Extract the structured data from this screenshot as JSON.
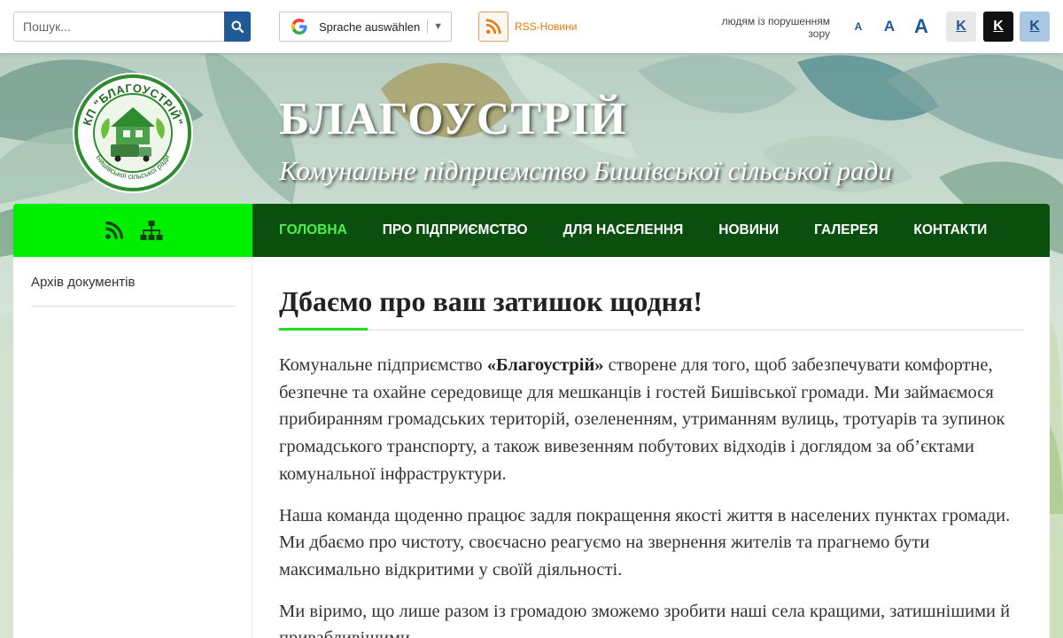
{
  "search": {
    "placeholder": "Пошук..."
  },
  "translate": {
    "label": "Sprache auswählen",
    "caret": "▼"
  },
  "rss_top": {
    "label": "RSS-Новини"
  },
  "accessibility": {
    "label": "людям із порушенням зору",
    "font_sizes": [
      "A",
      "A",
      "A"
    ],
    "contrast_buttons": [
      "K",
      "K",
      "K"
    ]
  },
  "header": {
    "title": "БЛАГОУСТРІЙ",
    "subtitle": "Комунальне підприємство Бишівської сільської ради",
    "logo_top": "КП \"БЛАГОУСТРІЙ\"",
    "logo_bottom": "Бишівської сільської ради"
  },
  "nav": {
    "items": [
      {
        "label": "ГОЛОВНА",
        "active": true
      },
      {
        "label": "ПРО ПІДПРИЄМСТВО",
        "active": false
      },
      {
        "label": "ДЛЯ НАСЕЛЕННЯ",
        "active": false
      },
      {
        "label": "НОВИНИ",
        "active": false
      },
      {
        "label": "ГАЛЕРЕЯ",
        "active": false
      },
      {
        "label": "КОНТАКТИ",
        "active": false
      }
    ],
    "left_icons": [
      "rss-icon",
      "sitemap-icon"
    ]
  },
  "sidebar": {
    "links": [
      {
        "label": "Архів документів"
      }
    ]
  },
  "main": {
    "title": "Дбаємо про ваш затишок щодня!",
    "p1_before": "Комунальне підприємство ",
    "p1_bold": "«Благоустрій»",
    "p1_after": " створене для того, щоб забезпечувати комфортне, безпечне та охайне середовище для мешканців і гостей Бишівської громади. Ми займаємося прибиранням громадських територій, озелененням, утриманням вулиць, тротуарів та зупинок громадського транспорту, а також вивезенням побутових відходів і доглядом за об’єктами комунальної інфраструктури.",
    "p2": "Наша команда щоденно працює задля покращення якості життя в населених пунктах громади. Ми дбаємо про чистоту, своєчасно реагуємо на звернення жителів та прагнемо бути максимально відкритими у своїй діяльності.",
    "p3": "Ми віримо, що лише разом із громадою зможемо зробити наші села кращими, затишнішими й привабливішими."
  },
  "colors": {
    "nav_dark": "#0b4f0f",
    "nav_bright": "#00ee00",
    "nav_active": "#4cf04c",
    "accent_blue": "#1f5a96",
    "rss_orange": "#e07a10"
  }
}
